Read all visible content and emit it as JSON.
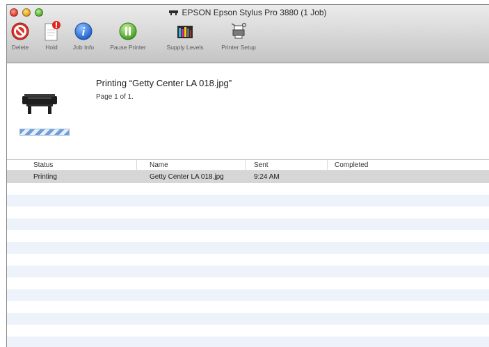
{
  "window": {
    "title": "EPSON Epson Stylus Pro 3880 (1 Job)"
  },
  "toolbar": {
    "items": [
      {
        "label": "Delete",
        "icon": "delete-icon"
      },
      {
        "label": "Hold",
        "icon": "hold-icon"
      },
      {
        "label": "Job Info",
        "icon": "info-icon"
      },
      {
        "label": "Pause Printer",
        "icon": "pause-icon"
      },
      {
        "label": "Supply Levels",
        "icon": "supply-levels-icon"
      },
      {
        "label": "Printer Setup",
        "icon": "printer-setup-icon"
      }
    ]
  },
  "job": {
    "title": "Printing “Getty Center LA 018.jpg”",
    "subtitle": "Page 1 of 1."
  },
  "table": {
    "columns": [
      "Status",
      "Name",
      "Sent",
      "Completed"
    ],
    "rows": [
      {
        "status": "Printing",
        "name": "Getty Center LA 018.jpg",
        "sent": "9:24 AM",
        "completed": ""
      }
    ]
  },
  "colors": {
    "selected_row": "#d6d6d6",
    "alt_row": "#eef3fb",
    "progress": "#6f9fd6"
  }
}
